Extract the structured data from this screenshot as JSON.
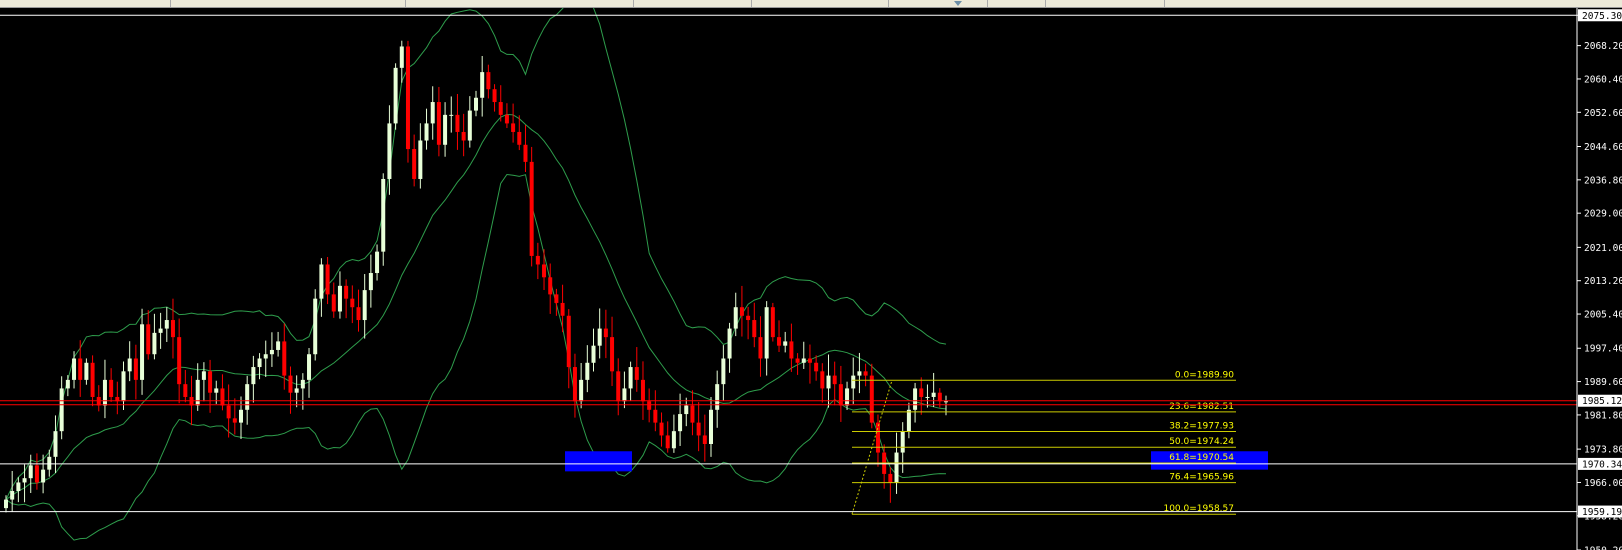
{
  "window": {
    "toolbar_marker_color": "#6d8fa8"
  },
  "colors": {
    "background": "#000000",
    "bull": "#e8ffd8",
    "bear": "#ff0000",
    "bands": "#2e9d4c",
    "fib": "#cccc00",
    "fib_text": "#ffff00",
    "zone": "#0000ff",
    "current_price_line": "#ff0000",
    "hline": "#ffffff"
  },
  "chart_data": {
    "type": "candlestick",
    "instrument": "",
    "ylim": [
      1950.2,
      2077.0
    ],
    "y_ticks": [
      "2075.30",
      "2068.20",
      "2060.40",
      "2052.60",
      "2044.60",
      "2036.80",
      "2029.00",
      "2021.00",
      "2013.20",
      "2005.40",
      "1997.40",
      "1989.60",
      "1981.80",
      "1973.80",
      "1966.00",
      "1958.20",
      "1950.20"
    ],
    "current_price": "1985.12",
    "horizontal_lines": [
      {
        "label": "2075.30",
        "price": 2075.3
      },
      {
        "label": "1970.34",
        "price": 1970.34
      },
      {
        "label": "1959.19",
        "price": 1959.19
      }
    ],
    "fibonacci": {
      "levels": [
        {
          "label": "0.0=1989.90",
          "price": 1989.9
        },
        {
          "label": "23.6=1982.51",
          "price": 1982.51
        },
        {
          "label": "38.2=1977.93",
          "price": 1977.93
        },
        {
          "label": "50.0=1974.24",
          "price": 1974.24
        },
        {
          "label": "61.8=1970.54",
          "price": 1970.54
        },
        {
          "label": "76.4=1965.96",
          "price": 1965.96
        },
        {
          "label": "100.0=1958.57",
          "price": 1958.57
        }
      ]
    },
    "zones": [
      {
        "name": "support-zone-left",
        "price_high": 1973.3,
        "price_low": 1968.6
      },
      {
        "name": "support-zone-right",
        "price_high": 1973.3,
        "price_low": 1969.0
      }
    ],
    "candles_close": [
      1962,
      1964,
      1966,
      1967,
      1970,
      1966,
      1969,
      1972,
      1978,
      1988,
      1990,
      1995,
      1990,
      1994,
      1986,
      1984,
      1990,
      1986,
      1985,
      1992,
      1995,
      1990,
      2003,
      1996,
      2001,
      2002,
      2004,
      2000,
      1989,
      1986,
      1984,
      1990,
      1992,
      1987,
      1988,
      1984,
      1981,
      1980,
      1983,
      1989,
      1993,
      1995,
      1996,
      1997,
      1999,
      1991,
      1987,
      1988,
      1990,
      1996,
      2009,
      2017,
      2010,
      2006,
      2012,
      2009,
      2007,
      2004,
      2011,
      2015,
      2020,
      2037,
      2050,
      2063,
      2068,
      2044,
      2037,
      2046,
      2050,
      2055,
      2045,
      2052,
      2052,
      2048,
      2046,
      2053,
      2056,
      2062,
      2058,
      2055,
      2052,
      2050,
      2048,
      2045,
      2041,
      2019,
      2017,
      2014,
      2010,
      2008,
      2005,
      1993,
      1985,
      1990,
      1994,
      1998,
      2002,
      2000,
      1992,
      1985,
      1988,
      1993,
      1990,
      1985,
      1983,
      1980,
      1977,
      1974,
      1978,
      1982,
      1984,
      1980,
      1977,
      1975,
      1983,
      1989,
      1995,
      2002,
      2007,
      2005,
      2004,
      2000,
      1995,
      2007,
      2000,
      1998,
      1999,
      1995,
      1994,
      1995,
      1994,
      1992,
      1988,
      1991,
      1989,
      1984,
      1988,
      1991,
      1992,
      1991,
      1980,
      1973,
      1968,
      1966,
      1973,
      1978,
      1983,
      1988,
      1986,
      1986,
      1987,
      1985,
      1985
    ]
  }
}
